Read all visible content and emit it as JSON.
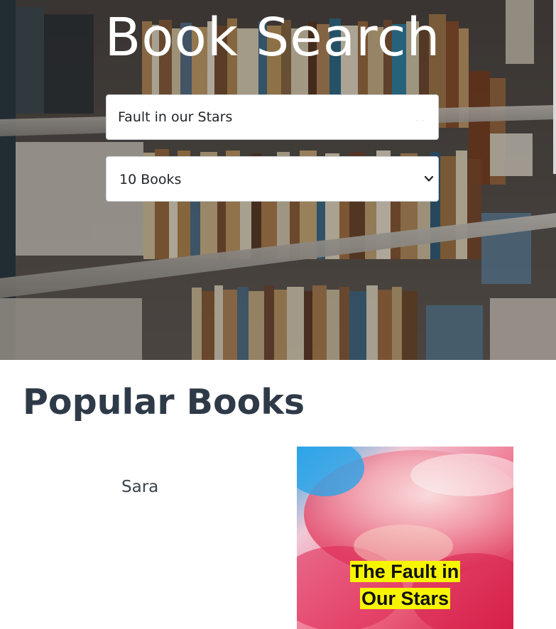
{
  "hero": {
    "title": "Book Search",
    "search": {
      "value": "Fault in our Stars",
      "placeholder": ""
    },
    "count_select": {
      "selected": "10 Books"
    }
  },
  "popular": {
    "heading": "Popular Books",
    "books": [
      {
        "author": "Sara",
        "cover_title_line1": "The Fault in",
        "cover_title_line2": "Our Stars"
      }
    ]
  },
  "icons": {
    "select_arrow": "chevron-down-icon"
  },
  "colors": {
    "heading": "#2f3a48",
    "hero_text": "#ffffff",
    "cover_title_highlight": "#f7f400"
  }
}
